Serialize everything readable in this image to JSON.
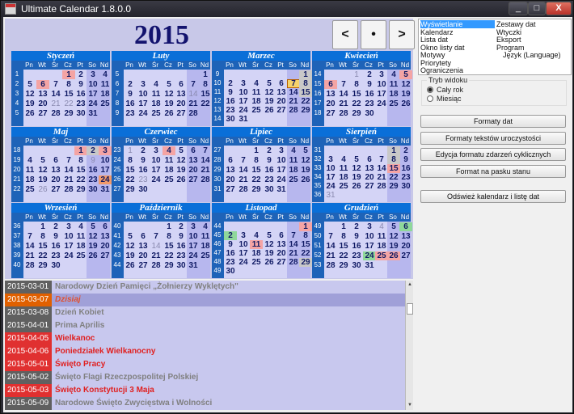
{
  "window": {
    "title": "Ultimate Calendar 1.8.0.0",
    "min": "_",
    "max": "□",
    "close": "X"
  },
  "calendar": {
    "year": "2015",
    "nav": {
      "prev": "<",
      "today": "•",
      "next": ">"
    },
    "dayNames": [
      "Pn",
      "Wt",
      "Śr",
      "Cz",
      "Pt",
      "So",
      "Nd"
    ],
    "months": [
      {
        "name": "Styczeń",
        "weeks": [
          "1",
          "2",
          "3",
          "4",
          "5"
        ],
        "rows": [
          [
            "",
            "",
            "",
            "1",
            "2",
            "3",
            "4"
          ],
          [
            "5",
            "6",
            "7",
            "8",
            "9",
            "10",
            "11"
          ],
          [
            "12",
            "13",
            "14",
            "15",
            "16",
            "17",
            "18"
          ],
          [
            "19",
            "20",
            "21",
            "22",
            "23",
            "24",
            "25"
          ],
          [
            "26",
            "27",
            "28",
            "29",
            "30",
            "31",
            ""
          ]
        ],
        "marks": {
          "1": "hol",
          "6": "hol",
          "21": "other",
          "22": "other"
        }
      },
      {
        "name": "Luty",
        "weeks": [
          "5",
          "6",
          "7",
          "8",
          "9"
        ],
        "rows": [
          [
            "",
            "",
            "",
            "",
            "",
            "",
            "1"
          ],
          [
            "2",
            "3",
            "4",
            "5",
            "6",
            "7",
            "8"
          ],
          [
            "9",
            "10",
            "11",
            "12",
            "13",
            "14",
            "15"
          ],
          [
            "16",
            "17",
            "18",
            "19",
            "20",
            "21",
            "22"
          ],
          [
            "23",
            "24",
            "25",
            "26",
            "27",
            "28",
            ""
          ]
        ],
        "marks": {
          "14": "other"
        }
      },
      {
        "name": "Marzec",
        "weeks": [
          "9",
          "10",
          "11",
          "12",
          "13",
          "14"
        ],
        "rows": [
          [
            "",
            "",
            "",
            "",
            "",
            "",
            "1"
          ],
          [
            "2",
            "3",
            "4",
            "5",
            "6",
            "7",
            "8"
          ],
          [
            "9",
            "10",
            "11",
            "12",
            "13",
            "14",
            "15"
          ],
          [
            "16",
            "17",
            "18",
            "19",
            "20",
            "21",
            "22"
          ],
          [
            "23",
            "24",
            "25",
            "26",
            "27",
            "28",
            "29"
          ],
          [
            "30",
            "31",
            "",
            "",
            "",
            "",
            ""
          ]
        ],
        "marks": {
          "1": "gray",
          "7": "today",
          "8": "gray",
          "15": "gray"
        }
      },
      {
        "name": "Kwiecień",
        "weeks": [
          "14",
          "15",
          "16",
          "17",
          "18"
        ],
        "rows": [
          [
            "",
            "",
            "1",
            "2",
            "3",
            "4",
            "5"
          ],
          [
            "6",
            "7",
            "8",
            "9",
            "10",
            "11",
            "12"
          ],
          [
            "13",
            "14",
            "15",
            "16",
            "17",
            "18",
            "19"
          ],
          [
            "20",
            "21",
            "22",
            "23",
            "24",
            "25",
            "26"
          ],
          [
            "27",
            "28",
            "29",
            "30",
            "",
            "",
            ""
          ]
        ],
        "marks": {
          "1": "other",
          "5": "hol",
          "6": "hol"
        }
      },
      {
        "name": "Maj",
        "weeks": [
          "18",
          "19",
          "20",
          "21",
          "22"
        ],
        "rows": [
          [
            "",
            "",
            "",
            "",
            "1",
            "2",
            "3"
          ],
          [
            "4",
            "5",
            "6",
            "7",
            "8",
            "9",
            "10"
          ],
          [
            "11",
            "12",
            "13",
            "14",
            "15",
            "16",
            "17"
          ],
          [
            "18",
            "19",
            "20",
            "21",
            "22",
            "23",
            "24"
          ],
          [
            "25",
            "26",
            "27",
            "28",
            "29",
            "30",
            "31"
          ]
        ],
        "marks": {
          "1": "hol",
          "2": "gray",
          "3": "hol",
          "9": "other",
          "24": "orange",
          "26": "other"
        }
      },
      {
        "name": "Czerwiec",
        "weeks": [
          "23",
          "24",
          "25",
          "26",
          "27"
        ],
        "rows": [
          [
            "1",
            "2",
            "3",
            "4",
            "5",
            "6",
            "7"
          ],
          [
            "8",
            "9",
            "10",
            "11",
            "12",
            "13",
            "14"
          ],
          [
            "15",
            "16",
            "17",
            "18",
            "19",
            "20",
            "21"
          ],
          [
            "22",
            "23",
            "24",
            "25",
            "26",
            "27",
            "28"
          ],
          [
            "29",
            "30",
            "",
            "",
            "",
            "",
            ""
          ]
        ],
        "marks": {
          "1": "other",
          "4": "hol",
          "23": "other"
        }
      },
      {
        "name": "Lipiec",
        "weeks": [
          "27",
          "28",
          "29",
          "30",
          "31"
        ],
        "rows": [
          [
            "",
            "",
            "1",
            "2",
            "3",
            "4",
            "5"
          ],
          [
            "6",
            "7",
            "8",
            "9",
            "10",
            "11",
            "12"
          ],
          [
            "13",
            "14",
            "15",
            "16",
            "17",
            "18",
            "19"
          ],
          [
            "20",
            "21",
            "22",
            "23",
            "24",
            "25",
            "26"
          ],
          [
            "27",
            "28",
            "29",
            "30",
            "31",
            "",
            ""
          ]
        ],
        "marks": {}
      },
      {
        "name": "Sierpień",
        "weeks": [
          "31",
          "32",
          "33",
          "34",
          "35",
          "36"
        ],
        "rows": [
          [
            "",
            "",
            "",
            "",
            "",
            "1",
            "2"
          ],
          [
            "3",
            "4",
            "5",
            "6",
            "7",
            "8",
            "9"
          ],
          [
            "10",
            "11",
            "12",
            "13",
            "14",
            "15",
            "16"
          ],
          [
            "17",
            "18",
            "19",
            "20",
            "21",
            "22",
            "23"
          ],
          [
            "24",
            "25",
            "26",
            "27",
            "28",
            "29",
            "30"
          ],
          [
            "31",
            "",
            "",
            "",
            "",
            "",
            ""
          ]
        ],
        "marks": {
          "1": "gray",
          "8": "gray",
          "15": "hol",
          "31": "other"
        }
      },
      {
        "name": "Wrzesień",
        "weeks": [
          "36",
          "37",
          "38",
          "39",
          "40"
        ],
        "rows": [
          [
            "",
            "1",
            "2",
            "3",
            "4",
            "5",
            "6"
          ],
          [
            "7",
            "8",
            "9",
            "10",
            "11",
            "12",
            "13"
          ],
          [
            "14",
            "15",
            "16",
            "17",
            "18",
            "19",
            "20"
          ],
          [
            "21",
            "22",
            "23",
            "24",
            "25",
            "26",
            "27"
          ],
          [
            "28",
            "29",
            "30",
            "",
            "",
            "",
            ""
          ]
        ],
        "marks": {}
      },
      {
        "name": "Październik",
        "weeks": [
          "40",
          "41",
          "42",
          "43",
          "44"
        ],
        "rows": [
          [
            "",
            "",
            "",
            "1",
            "2",
            "3",
            "4"
          ],
          [
            "5",
            "6",
            "7",
            "8",
            "9",
            "10",
            "11"
          ],
          [
            "12",
            "13",
            "14",
            "15",
            "16",
            "17",
            "18"
          ],
          [
            "19",
            "20",
            "21",
            "22",
            "23",
            "24",
            "25"
          ],
          [
            "26",
            "27",
            "28",
            "29",
            "30",
            "31",
            ""
          ]
        ],
        "marks": {
          "14": "other"
        }
      },
      {
        "name": "Listopad",
        "weeks": [
          "44",
          "45",
          "46",
          "47",
          "48",
          "49"
        ],
        "rows": [
          [
            "",
            "",
            "",
            "",
            "",
            "",
            "1"
          ],
          [
            "2",
            "3",
            "4",
            "5",
            "6",
            "7",
            "8"
          ],
          [
            "9",
            "10",
            "11",
            "12",
            "13",
            "14",
            "15"
          ],
          [
            "16",
            "17",
            "18",
            "19",
            "20",
            "21",
            "22"
          ],
          [
            "23",
            "24",
            "25",
            "26",
            "27",
            "28",
            "29"
          ],
          [
            "30",
            "",
            "",
            "",
            "",
            "",
            ""
          ]
        ],
        "marks": {
          "1": "hol",
          "2": "green",
          "11": "hol",
          "29": "gray"
        }
      },
      {
        "name": "Grudzień",
        "weeks": [
          "49",
          "50",
          "51",
          "52",
          "53"
        ],
        "rows": [
          [
            "",
            "1",
            "2",
            "3",
            "4",
            "5",
            "6"
          ],
          [
            "7",
            "8",
            "9",
            "10",
            "11",
            "12",
            "13"
          ],
          [
            "14",
            "15",
            "16",
            "17",
            "18",
            "19",
            "20"
          ],
          [
            "21",
            "22",
            "23",
            "24",
            "25",
            "26",
            "27"
          ],
          [
            "28",
            "29",
            "30",
            "31",
            "",
            "",
            ""
          ]
        ],
        "marks": {
          "4": "other",
          "6": "green",
          "24": "green",
          "25": "hol",
          "26": "hol"
        }
      }
    ]
  },
  "menu": {
    "items": [
      "Wyświetlanie",
      "Kalendarz",
      "Lista dat",
      "Okno listy dat",
      "Motywy",
      "Priorytety",
      "Ograniczenia",
      "Zestawy dat",
      "Wtyczki",
      "Eksport",
      "Program",
      "Język (Language)"
    ]
  },
  "viewMode": {
    "title": "Tryb widoku",
    "options": [
      "Cały rok",
      "Miesiąc"
    ]
  },
  "buttons": [
    "Formaty dat",
    "Formaty tekstów uroczystości",
    "Edycja formatu zdarzeń cyklicznych",
    "Format na pasku stanu",
    "Odśwież kalendarz i listę dat"
  ],
  "events": [
    {
      "date": "2015-03-01",
      "name": "Narodowy Dzień Pamięci „Żołnierzy Wyklętych\"",
      "dateColor": "#606060",
      "nameColor": "#808080"
    },
    {
      "date": "2015-03-07",
      "name": "Dzisiaj",
      "dateColor": "#e06000",
      "nameColor": "#e05030"
    },
    {
      "date": "2015-03-08",
      "name": "Dzień Kobiet",
      "dateColor": "#606060",
      "nameColor": "#808080"
    },
    {
      "date": "2015-04-01",
      "name": "Prima Aprilis",
      "dateColor": "#606060",
      "nameColor": "#808080"
    },
    {
      "date": "2015-04-05",
      "name": "Wielkanoc",
      "dateColor": "#e03030",
      "nameColor": "#e02020"
    },
    {
      "date": "2015-04-06",
      "name": "Poniedziałek Wielkanocny",
      "dateColor": "#e03030",
      "nameColor": "#e02020"
    },
    {
      "date": "2015-05-01",
      "name": "Święto Pracy",
      "dateColor": "#e03030",
      "nameColor": "#e02020"
    },
    {
      "date": "2015-05-02",
      "name": "Święto Flagi Rzeczpospolitej Polskiej",
      "dateColor": "#606060",
      "nameColor": "#808080"
    },
    {
      "date": "2015-05-03",
      "name": "Święto Konstytucji 3 Maja",
      "dateColor": "#e03030",
      "nameColor": "#e02020"
    },
    {
      "date": "2015-05-09",
      "name": "Narodowe Święto Zwycięstwa i Wolności",
      "dateColor": "#606060",
      "nameColor": "#808080"
    }
  ]
}
